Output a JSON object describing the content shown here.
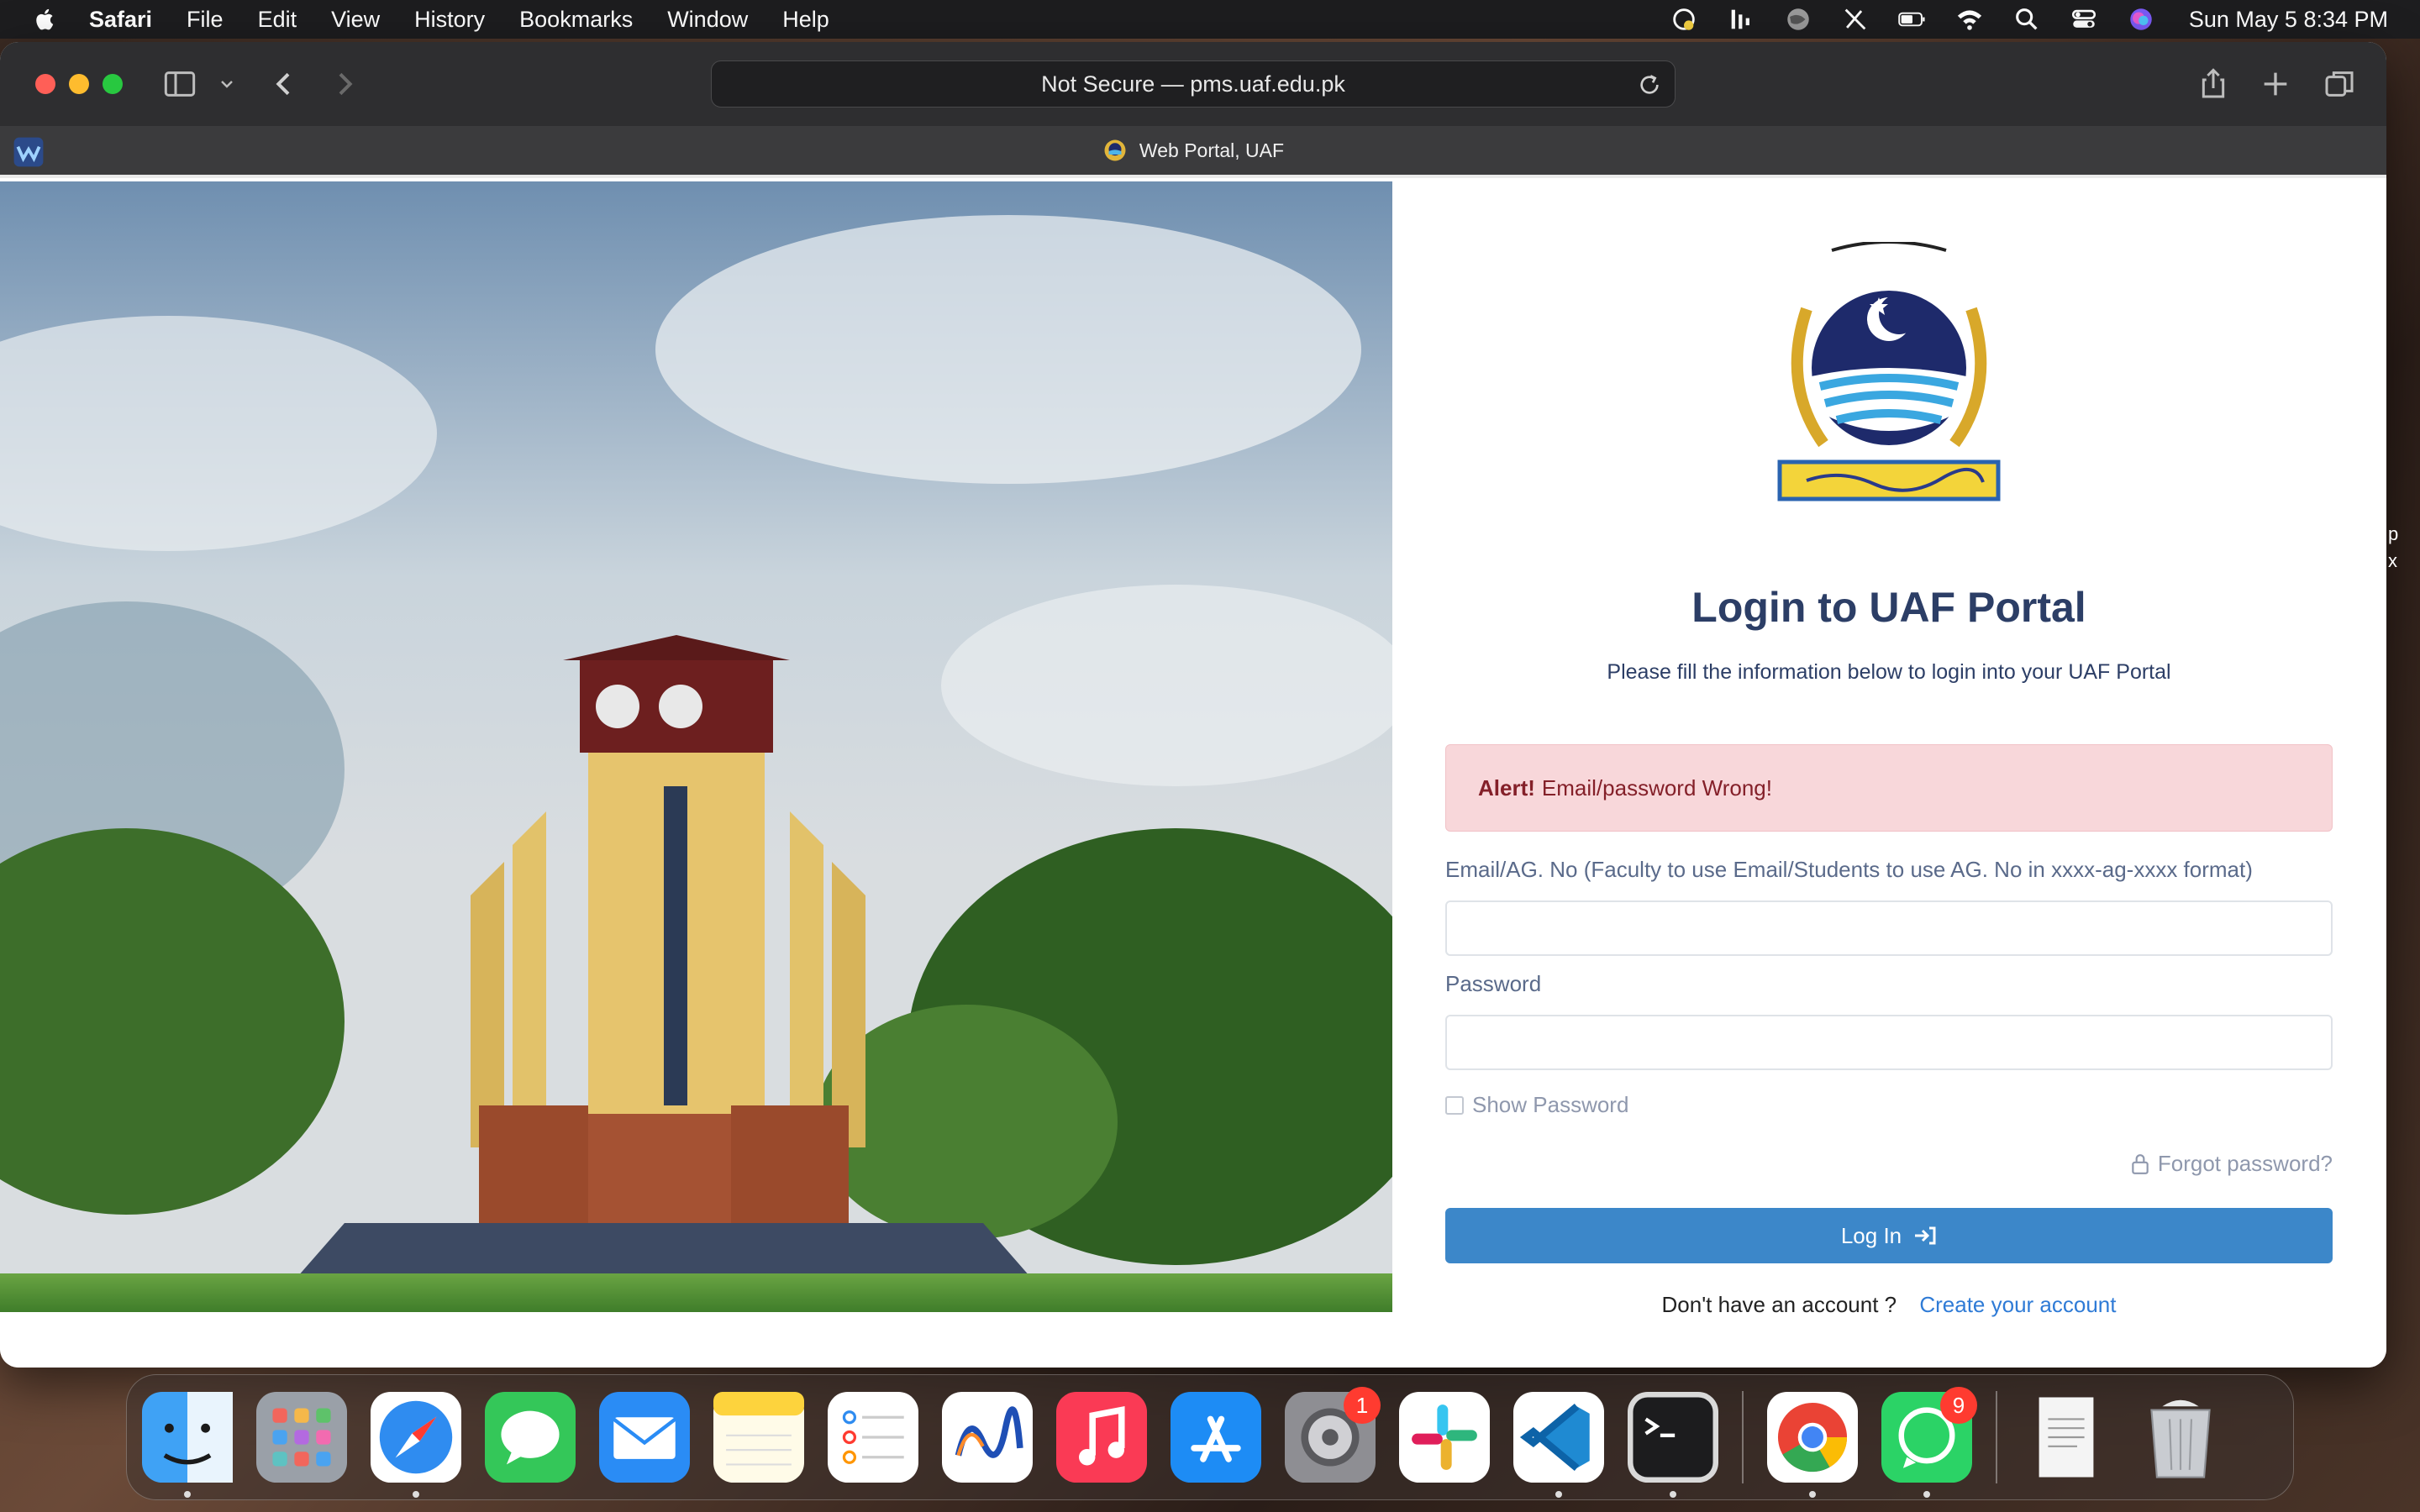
{
  "menubar": {
    "app_name": "Safari",
    "items": [
      "File",
      "Edit",
      "View",
      "History",
      "Bookmarks",
      "Window",
      "Help"
    ],
    "clock": "Sun May 5  8:34 PM"
  },
  "browser": {
    "address": "Not Secure — pms.uaf.edu.pk",
    "tab_title": "Web Portal, UAF"
  },
  "login": {
    "title": "Login to UAF Portal",
    "subtitle": "Please fill the information below to login into your UAF Portal",
    "alert_strong": "Alert!",
    "alert_text": "Email/password Wrong!",
    "email_label": "Email/AG. No (Faculty to use Email/Students to use AG. No in xxxx-ag-xxxx format)",
    "email_value": "",
    "password_label": "Password",
    "password_value": "",
    "show_password": "Show Password",
    "forgot": "Forgot password?",
    "login_button": "Log In",
    "no_account": "Don't have an account ?",
    "create_account": "Create your account"
  },
  "edge_text": [
    "p",
    "x"
  ],
  "dock": {
    "apps": [
      {
        "name": "Finder"
      },
      {
        "name": "Launchpad"
      },
      {
        "name": "Safari"
      },
      {
        "name": "Messages"
      },
      {
        "name": "Mail"
      },
      {
        "name": "Notes"
      },
      {
        "name": "Reminders"
      },
      {
        "name": "Freeform"
      },
      {
        "name": "Music"
      },
      {
        "name": "App Store"
      },
      {
        "name": "System Settings",
        "badge": "1"
      },
      {
        "name": "Slack"
      },
      {
        "name": "Visual Studio Code"
      },
      {
        "name": "Terminal"
      },
      {
        "name": "Google Chrome"
      },
      {
        "name": "WhatsApp",
        "badge": "9"
      },
      {
        "name": "Document"
      },
      {
        "name": "Trash"
      }
    ]
  },
  "colors": {
    "primary_button": "#3c87c9",
    "alert_bg": "#f8d7da",
    "alert_text": "#842029",
    "title": "#2c3e66",
    "link": "#2f7bd6"
  }
}
